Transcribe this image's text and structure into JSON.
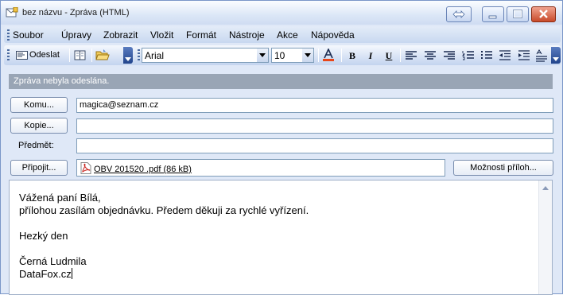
{
  "window": {
    "title": "bez názvu - Zpráva (HTML)"
  },
  "menu": {
    "items": [
      "Soubor",
      "Úpravy",
      "Zobrazit",
      "Vložit",
      "Formát",
      "Nástroje",
      "Akce",
      "Nápověda"
    ]
  },
  "toolbar": {
    "send_label": "Odeslat",
    "font_name": "Arial",
    "font_size": "10",
    "bold": "B",
    "italic": "I",
    "underline": "U"
  },
  "infobar": {
    "message": "Zpráva nebyla odeslána."
  },
  "fields": {
    "to_button": "Komu...",
    "to_value": "magica@seznam.cz",
    "cc_button": "Kopie...",
    "cc_value": "",
    "subject_label": "Předmět:",
    "subject_value": "",
    "attach_button": "Připojit...",
    "attachment_name": "OBV 201520 .pdf (86 kB)",
    "attach_options_button": "Možnosti příloh..."
  },
  "body": {
    "lines": [
      "Vážená paní Bílá,",
      "přílohou zasílám objednávku. Předem děkuji za rychlé vyřízení.",
      "",
      "Hezký den",
      "",
      "Černá Ludmila",
      "DataFox.cz"
    ]
  },
  "colors": {
    "window_bg": "#dfe8f7",
    "infobar_bg": "#99a5b5",
    "close_button": "#c84a2a"
  }
}
